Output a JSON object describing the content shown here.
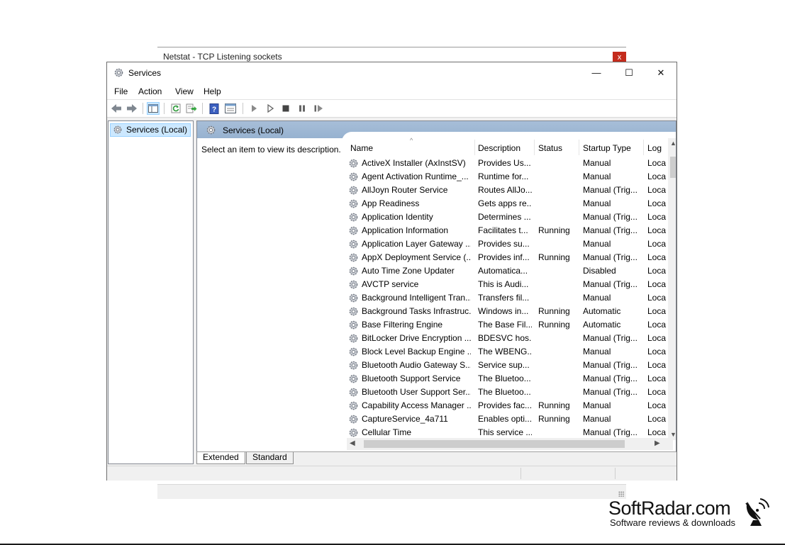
{
  "background_window": {
    "title": "Netstat - TCP Listening sockets",
    "close_glyph": "x"
  },
  "window": {
    "title": "Services",
    "icon": "gear-icon",
    "controls": {
      "minimize": "—",
      "maximize": "☐",
      "close": "✕"
    }
  },
  "menu": [
    "File",
    "Action",
    "View",
    "Help"
  ],
  "toolbar": {
    "buttons": [
      "back-icon",
      "forward-icon",
      "show-hide-console-tree-icon",
      "refresh-icon",
      "export-list-icon",
      "help-icon",
      "properties-icon",
      "start-service-icon",
      "start-alt-icon",
      "stop-service-icon",
      "pause-service-icon",
      "restart-service-icon"
    ]
  },
  "tree": {
    "root": "Services (Local)"
  },
  "pane": {
    "header": "Services (Local)",
    "description_prompt": "Select an item to view its description."
  },
  "columns": {
    "name": "Name",
    "description": "Description",
    "status": "Status",
    "startup_type": "Startup Type",
    "log_on_as": "Log"
  },
  "services": [
    {
      "name": "ActiveX Installer (AxInstSV)",
      "description": "Provides Us...",
      "status": "",
      "startup": "Manual",
      "logon": "Loca"
    },
    {
      "name": "Agent Activation Runtime_...",
      "description": "Runtime for...",
      "status": "",
      "startup": "Manual",
      "logon": "Loca"
    },
    {
      "name": "AllJoyn Router Service",
      "description": "Routes AllJo...",
      "status": "",
      "startup": "Manual (Trig...",
      "logon": "Loca"
    },
    {
      "name": "App Readiness",
      "description": "Gets apps re...",
      "status": "",
      "startup": "Manual",
      "logon": "Loca"
    },
    {
      "name": "Application Identity",
      "description": "Determines ...",
      "status": "",
      "startup": "Manual (Trig...",
      "logon": "Loca"
    },
    {
      "name": "Application Information",
      "description": "Facilitates t...",
      "status": "Running",
      "startup": "Manual (Trig...",
      "logon": "Loca"
    },
    {
      "name": "Application Layer Gateway ...",
      "description": "Provides su...",
      "status": "",
      "startup": "Manual",
      "logon": "Loca"
    },
    {
      "name": "AppX Deployment Service (...",
      "description": "Provides inf...",
      "status": "Running",
      "startup": "Manual (Trig...",
      "logon": "Loca"
    },
    {
      "name": "Auto Time Zone Updater",
      "description": "Automatica...",
      "status": "",
      "startup": "Disabled",
      "logon": "Loca"
    },
    {
      "name": "AVCTP service",
      "description": "This is Audi...",
      "status": "",
      "startup": "Manual (Trig...",
      "logon": "Loca"
    },
    {
      "name": "Background Intelligent Tran...",
      "description": "Transfers fil...",
      "status": "",
      "startup": "Manual",
      "logon": "Loca"
    },
    {
      "name": "Background Tasks Infrastruc...",
      "description": "Windows in...",
      "status": "Running",
      "startup": "Automatic",
      "logon": "Loca"
    },
    {
      "name": "Base Filtering Engine",
      "description": "The Base Fil...",
      "status": "Running",
      "startup": "Automatic",
      "logon": "Loca"
    },
    {
      "name": "BitLocker Drive Encryption ...",
      "description": "BDESVC hos...",
      "status": "",
      "startup": "Manual (Trig...",
      "logon": "Loca"
    },
    {
      "name": "Block Level Backup Engine ...",
      "description": "The WBENG...",
      "status": "",
      "startup": "Manual",
      "logon": "Loca"
    },
    {
      "name": "Bluetooth Audio Gateway S...",
      "description": "Service sup...",
      "status": "",
      "startup": "Manual (Trig...",
      "logon": "Loca"
    },
    {
      "name": "Bluetooth Support Service",
      "description": "The Bluetoo...",
      "status": "",
      "startup": "Manual (Trig...",
      "logon": "Loca"
    },
    {
      "name": "Bluetooth User Support Ser...",
      "description": "The Bluetoo...",
      "status": "",
      "startup": "Manual (Trig...",
      "logon": "Loca"
    },
    {
      "name": "Capability Access Manager ...",
      "description": "Provides fac...",
      "status": "Running",
      "startup": "Manual",
      "logon": "Loca"
    },
    {
      "name": "CaptureService_4a711",
      "description": "Enables opti...",
      "status": "Running",
      "startup": "Manual",
      "logon": "Loca"
    },
    {
      "name": "Cellular Time",
      "description": "This service ...",
      "status": "",
      "startup": "Manual (Trig...",
      "logon": "Loca"
    }
  ],
  "tabs": [
    "Extended",
    "Standard"
  ],
  "watermark": {
    "brand": "SoftRadar.com",
    "tagline": "Software reviews & downloads"
  }
}
